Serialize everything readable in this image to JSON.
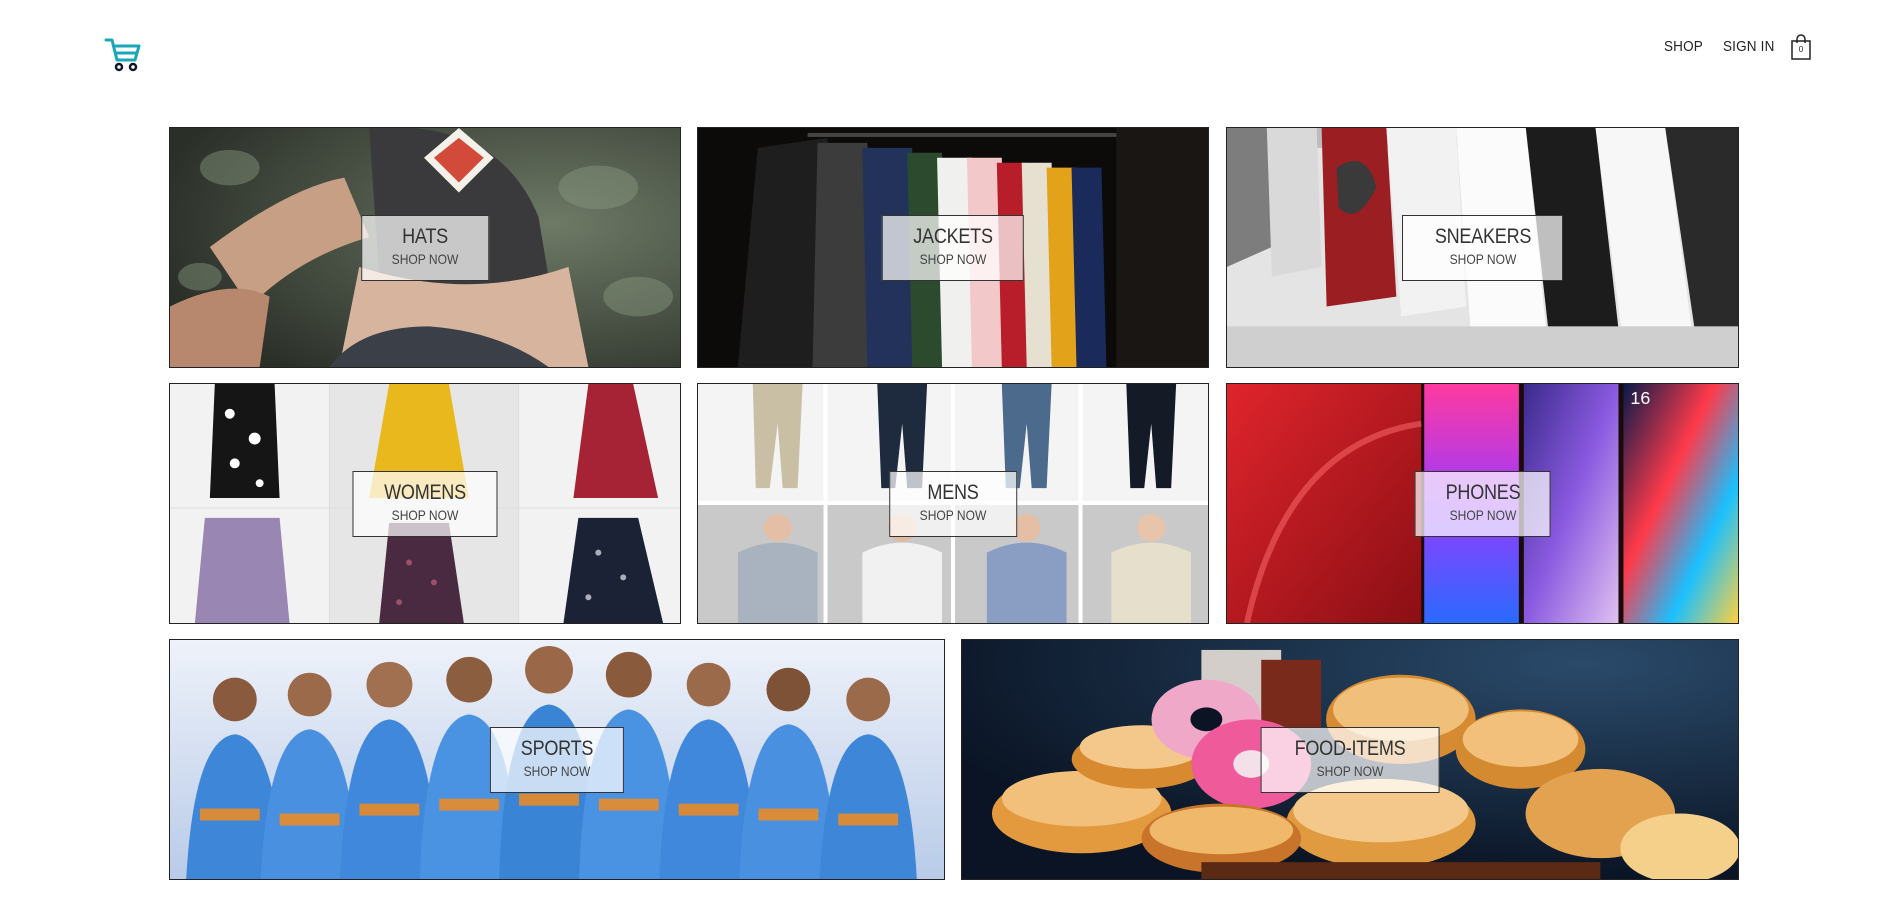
{
  "header": {
    "logo_icon": "shopping-cart-icon",
    "nav": {
      "shop": "SHOP",
      "sign_in": "SIGN IN",
      "cart_icon": "shopping-bag-icon",
      "cart_count": "0"
    }
  },
  "directory": {
    "cta": "SHOP NOW",
    "items": [
      {
        "title": "HATS",
        "subtitle": "SHOP NOW"
      },
      {
        "title": "JACKETS",
        "subtitle": "SHOP NOW"
      },
      {
        "title": "SNEAKERS",
        "subtitle": "SHOP NOW"
      },
      {
        "title": "WOMENS",
        "subtitle": "SHOP NOW"
      },
      {
        "title": "MENS",
        "subtitle": "SHOP NOW"
      },
      {
        "title": "PHONES",
        "subtitle": "SHOP NOW"
      },
      {
        "title": "SPORTS",
        "subtitle": "SHOP NOW"
      },
      {
        "title": "FOOD-ITEMS",
        "subtitle": "SHOP NOW"
      }
    ]
  },
  "colors": {
    "logo": "#1aa7b8",
    "text": "#222222",
    "border": "#222222"
  }
}
